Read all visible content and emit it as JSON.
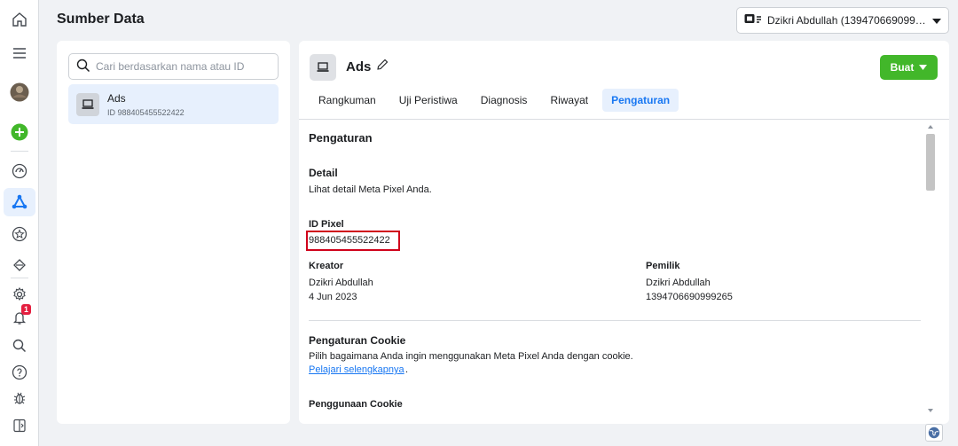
{
  "header": {
    "title": "Sumber Data",
    "account": "Dzikri Abdullah (1394706690999..."
  },
  "rail": {
    "notification_count": "1"
  },
  "sidebar": {
    "search_placeholder": "Cari berdasarkan nama atau ID",
    "items": [
      {
        "name": "Ads",
        "id": "ID 988405455522422"
      }
    ]
  },
  "detail": {
    "title": "Ads",
    "create_button": "Buat",
    "tabs": [
      "Rangkuman",
      "Uji Peristiwa",
      "Diagnosis",
      "Riwayat",
      "Pengaturan"
    ],
    "active_tab": "Pengaturan"
  },
  "settings": {
    "heading": "Pengaturan",
    "detail_heading": "Detail",
    "detail_desc": "Lihat detail Meta Pixel Anda.",
    "pixel_id_label": "ID Pixel",
    "pixel_id_value": "988405455522422",
    "creator_label": "Kreator",
    "creator_name": "Dzikri Abdullah",
    "creator_date": "4 Jun 2023",
    "owner_label": "Pemilik",
    "owner_name": "Dzikri Abdullah",
    "owner_id": "1394706690999265",
    "cookie_heading": "Pengaturan Cookie",
    "cookie_desc": "Pilih bagaimana Anda ingin menggunakan Meta Pixel Anda dengan cookie.",
    "cookie_link": "Pelajari selengkapnya",
    "cookie_link_suffix": ".",
    "cookie_usage_heading": "Penggunaan Cookie"
  },
  "colors": {
    "accent": "#1877f2",
    "create_button": "#42b72a",
    "highlight_box": "#d0021b",
    "active_bg": "#e7f0fd"
  }
}
